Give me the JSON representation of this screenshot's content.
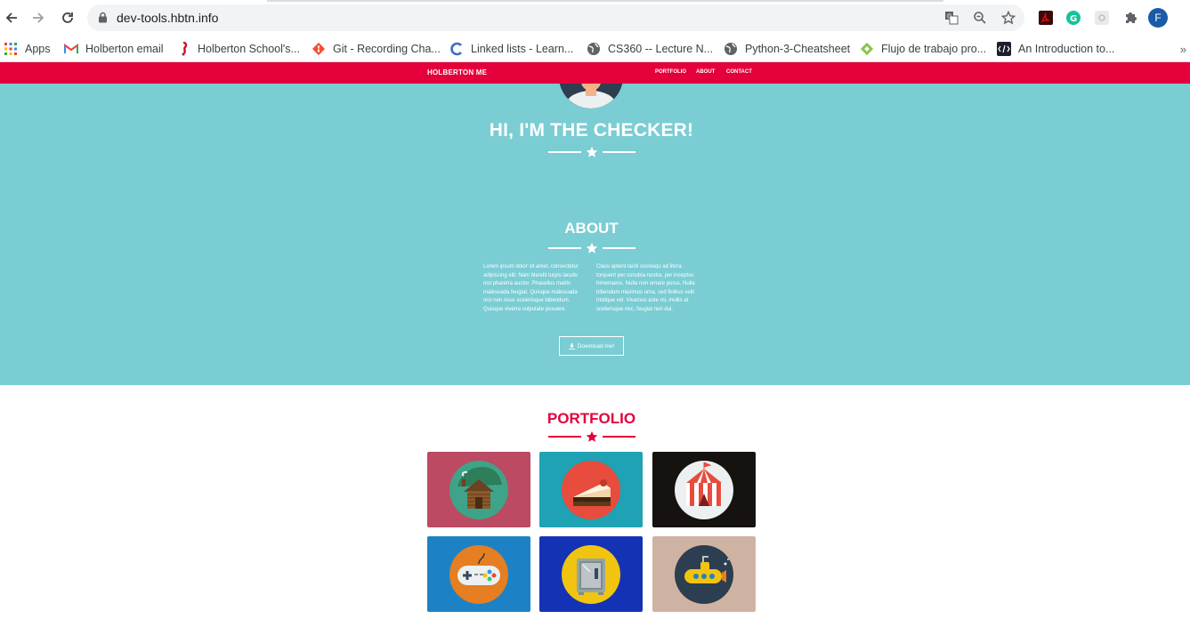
{
  "browser": {
    "url": "dev-tools.hbtn.info",
    "profile_initial": "F",
    "bookmarks": [
      {
        "label": "Apps",
        "icon": "apps-grid-icon"
      },
      {
        "label": "Holberton email",
        "icon": "gmail-icon"
      },
      {
        "label": "Holberton School's...",
        "icon": "holberton-icon"
      },
      {
        "label": "Git - Recording Cha...",
        "icon": "git-icon"
      },
      {
        "label": "Linked lists - Learn...",
        "icon": "c-icon"
      },
      {
        "label": "CS360 -- Lecture N...",
        "icon": "globe-icon"
      },
      {
        "label": "Python-3-Cheatsheet",
        "icon": "globe-icon"
      },
      {
        "label": "Flujo de trabajo pro...",
        "icon": "diamond-icon"
      },
      {
        "label": "An Introduction to...",
        "icon": "terminal-icon"
      }
    ],
    "more": "»"
  },
  "site": {
    "brand": "HOLBERTON ME",
    "nav": [
      "PORTFOLIO",
      "ABOUT",
      "CONTACT"
    ],
    "hero_title": "HI, I'M THE CHECKER!",
    "about_title": "ABOUT",
    "about_left": "Lorem ipsum dolor sit amet, consectetur adipiscing elit. Nam blandit turpis iaculis nisl pharetra auctor. Phasellus mattis malesuada feugiat. Quisque malesuada orci non risus scelerisque bibendum. Quisque viverra vulputate posuere.",
    "about_right": "Class aptent taciti sociosqu ad litora torquent per conubia nostra, per inceptos himenaeos. Nulla non ornare purus. Nulla bibendum maximus urna, sed finibus velit tristique vel. Vivamus ante mi, mollis at scelerisque nec, feugiat non dui.",
    "download_label": "Download me!",
    "portfolio_title": "PORTFOLIO",
    "portfolio_items": [
      {
        "icon": "cabin-icon",
        "bg": "#bb4a62"
      },
      {
        "icon": "cake-icon",
        "bg": "#1fa2b4"
      },
      {
        "icon": "circus-tent-icon",
        "bg": "#161210"
      },
      {
        "icon": "game-controller-icon",
        "bg": "#1c82c5"
      },
      {
        "icon": "safe-icon",
        "bg": "#1433b4"
      },
      {
        "icon": "submarine-icon",
        "bg": "#cfb3a2"
      }
    ]
  },
  "colors": {
    "brand_red": "#e4003a",
    "hero_teal": "#7acdd3"
  }
}
